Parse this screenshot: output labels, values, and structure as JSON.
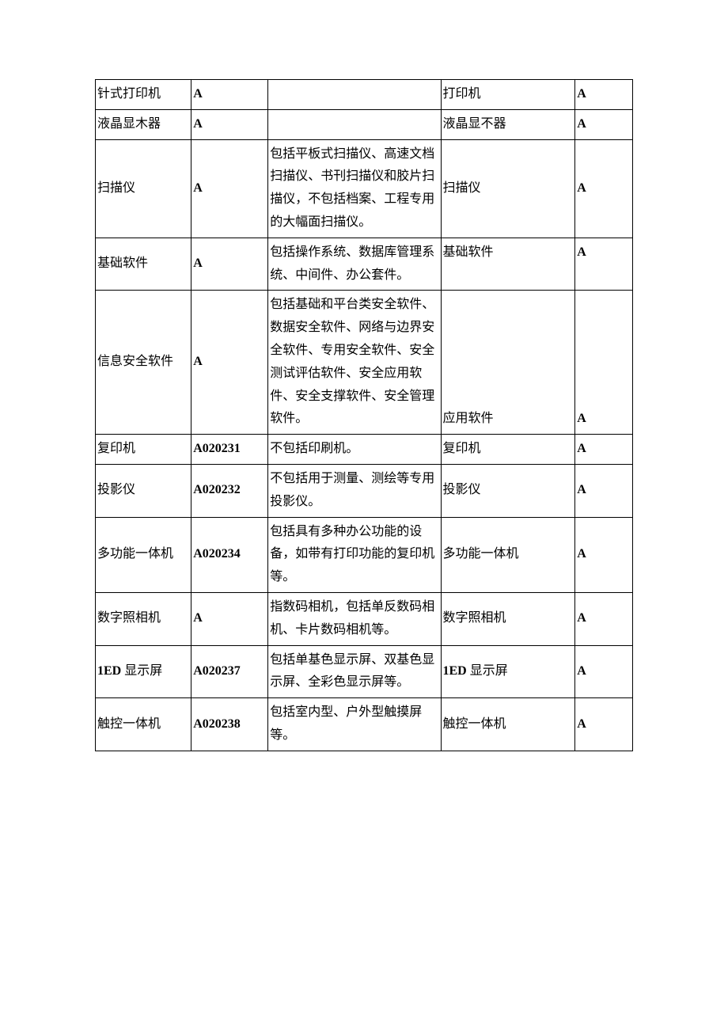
{
  "rows": [
    {
      "c1": "针式打印机",
      "c2": "A",
      "c2bold": true,
      "c3": "",
      "c4": "打印机",
      "c5": "A",
      "c5bold": true,
      "c4align": "top",
      "c5align": "top"
    },
    {
      "c1": "液晶显木器",
      "c2": "A",
      "c2bold": true,
      "c3": "",
      "c4": "液晶显不器",
      "c5": "A",
      "c5bold": true,
      "c4align": "top",
      "c5align": "top"
    },
    {
      "c1": "扫描仪",
      "c2": "A",
      "c2bold": true,
      "c3": "包括平板式扫描仪、高速文档扫描仪、书刊扫描仪和胶片扫描仪，不包括档案、工程专用的大幅面扫描仪。",
      "c4": "扫描仪",
      "c5": "A",
      "c5bold": true
    },
    {
      "c1": "基础软件",
      "c2": "A",
      "c2bold": true,
      "c3": "包括操作系统、数据库管理系统、中间件、办公套件。",
      "c4": "基础软件",
      "c5": "A",
      "c5bold": true,
      "c4align": "top",
      "c5align": "top"
    },
    {
      "c1": "信息安全软件",
      "c2": "A",
      "c2bold": true,
      "c3": "包括基础和平台类安全软件、数据安全软件、网络与边界安全软件、专用安全软件、安全测试评估软件、安全应用软件、安全支撑软件、安全管理软件。",
      "c4": "应用软件",
      "c5": "A",
      "c5bold": true,
      "c4align": "bottom",
      "c5align": "bottom"
    },
    {
      "c1": "复印机",
      "c2": "A020231",
      "c2bold": true,
      "c3": "不包括印刷机。",
      "c4": "复印机",
      "c5": "A",
      "c5bold": true,
      "c4align": "top",
      "c5align": "top"
    },
    {
      "c1": "投影仪",
      "c2": "A020232",
      "c2bold": true,
      "c3": "不包括用于测量、测绘等专用投影仪。",
      "c4": "投影仪",
      "c5": "A",
      "c5bold": true
    },
    {
      "c1": "多功能一体机",
      "c2": "A020234",
      "c2bold": true,
      "c3": "包括具有多种办公功能的设备，如带有打印功能的复印机等。",
      "c4": "多功能一体机",
      "c5": "A",
      "c5bold": true
    },
    {
      "c1": "数字照相机",
      "c2": "A",
      "c2bold": true,
      "c3": "指数码相机，包括单反数码相机、卡片数码相机等。",
      "c4": "数字照相机",
      "c5": "A",
      "c5bold": true,
      "c3align": "top"
    },
    {
      "c1": "1ED 显示屏",
      "c1mixed": true,
      "c2": "A020237",
      "c2bold": true,
      "c3": "包括单基色显示屏、双基色显示屏、全彩色显示屏等。",
      "c4": "1ED 显示屏",
      "c4mixed": true,
      "c5": "A",
      "c5bold": true
    },
    {
      "c1": "触控一体机",
      "c2": "A020238",
      "c2bold": true,
      "c3": "包括室内型、户外型触摸屏等。",
      "c4": "触控一体机",
      "c5": "A",
      "c5bold": true,
      "c3align": "top"
    }
  ]
}
